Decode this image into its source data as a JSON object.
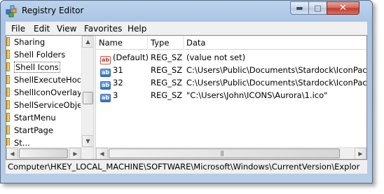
{
  "window": {
    "title": "Registry Editor",
    "minimize_icon": "minimize-icon",
    "maximize_icon": "maximize-icon",
    "close_icon": "close-icon",
    "close_color": "#c0392b"
  },
  "menu": [
    "File",
    "Edit",
    "View",
    "Favorites",
    "Help"
  ],
  "tree": {
    "items": [
      {
        "label": "Sharing",
        "selected": false
      },
      {
        "label": "Shell Folders",
        "selected": false
      },
      {
        "label": "Shell Icons",
        "selected": true
      },
      {
        "label": "ShellExecuteHoo",
        "selected": false
      },
      {
        "label": "ShellIconOverlay",
        "selected": false
      },
      {
        "label": "ShellServiceObje",
        "selected": false
      },
      {
        "label": "StartMenu",
        "selected": false
      },
      {
        "label": "StartPage",
        "selected": false
      },
      {
        "label": "St...",
        "selected": false
      }
    ]
  },
  "list": {
    "columns": [
      "Name",
      "Type",
      "Data"
    ],
    "rows": [
      {
        "icon": "string-value-icon",
        "name": "(Default)",
        "type": "REG_SZ",
        "data": "(value not set)"
      },
      {
        "icon": "binary-value-icon",
        "name": "31",
        "type": "REG_SZ",
        "data": "C:\\Users\\Public\\Documents\\Stardock\\IconPack"
      },
      {
        "icon": "binary-value-icon",
        "name": "32",
        "type": "REG_SZ",
        "data": "C:\\Users\\Public\\Documents\\Stardock\\IconPack"
      },
      {
        "icon": "binary-value-icon",
        "name": "3",
        "type": "REG_SZ",
        "data": "\"C:\\Users\\John\\ICONS\\Aurora\\1.ico\""
      }
    ]
  },
  "status": {
    "path": "Computer\\HKEY_LOCAL_MACHINE\\SOFTWARE\\Microsoft\\Windows\\CurrentVersion\\Explor"
  }
}
